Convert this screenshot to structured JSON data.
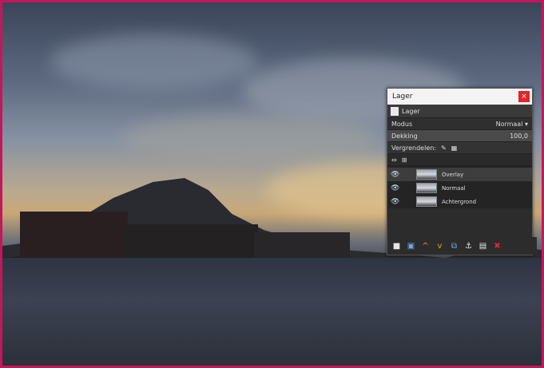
{
  "dialog": {
    "title": "Lager",
    "tab_label": "Lager",
    "mode_label": "Modus",
    "mode_value": "Normaal",
    "opacity_label": "Dekking",
    "opacity_value": "100,0",
    "lock_label": "Vergrendelen:",
    "layers": [
      {
        "name": "Overlay",
        "visible": true,
        "selected": true
      },
      {
        "name": "Normaal",
        "visible": true,
        "selected": false
      },
      {
        "name": "Achtergrond",
        "visible": true,
        "selected": false
      }
    ]
  },
  "icons": {
    "close": "close-icon",
    "eye": "eye-icon",
    "new_layer": "new-layer-icon",
    "new_group": "new-group-icon",
    "raise": "raise-layer-icon",
    "lower": "lower-layer-icon",
    "duplicate": "duplicate-layer-icon",
    "anchor": "anchor-layer-icon",
    "merge": "merge-layer-icon",
    "delete": "delete-layer-icon"
  },
  "colors": {
    "frame": "#c2185b",
    "close": "#e0262a",
    "accent_up": "#f59b1b",
    "accent_down": "#f59b1b",
    "delete": "#e0262a"
  }
}
